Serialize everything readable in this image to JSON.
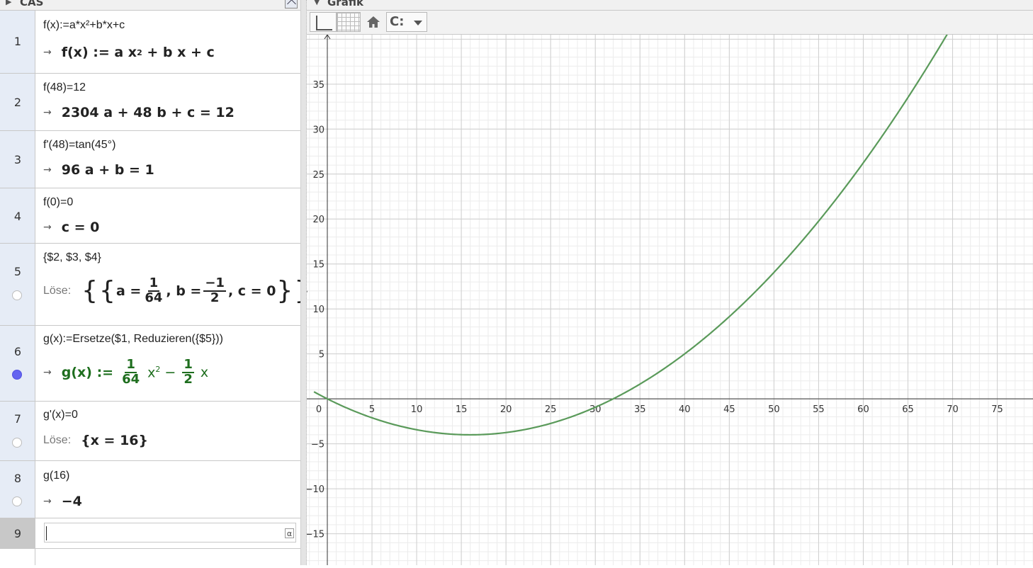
{
  "cas": {
    "title": "CAS",
    "rows": [
      {
        "n": "1",
        "input": "f(x):=a*x²+b*x+c"
      },
      {
        "n": "2",
        "input": "f(48)=12",
        "output": "2304 a + 48 b + c = 12"
      },
      {
        "n": "3",
        "input": "f'(48)=tan(45°)",
        "output": "96 a + b = 1"
      },
      {
        "n": "4",
        "input": "f(0)=0",
        "output": "c = 0"
      },
      {
        "n": "5",
        "input": "{$2, $3, $4}",
        "label": "Löse:"
      },
      {
        "n": "6",
        "input": "g(x):=Ersetze($1, Reduzieren({$5}))"
      },
      {
        "n": "7",
        "input": "g'(x)=0",
        "label": "Löse:",
        "output": "{x = 16}"
      },
      {
        "n": "8",
        "input": "g(16)",
        "output": "−4"
      },
      {
        "n": "9",
        "input": ""
      }
    ],
    "row1_output": {
      "lhs": "f(x) := a x",
      "exp": "2",
      "rest": " + b x + c"
    },
    "row5_output": {
      "a": "a =",
      "a_num": "1",
      "a_den": "64",
      "b": ", b =",
      "b_num": "−1",
      "b_den": "2",
      "c": ", c = 0"
    },
    "row6_output": {
      "lhs": "g(x) :=",
      "n1": "1",
      "d1": "64",
      "x2": "x",
      "exp": "2",
      "minus": "−",
      "n2": "1",
      "d2": "2",
      "x": "x"
    },
    "arrow": "→",
    "alpha": "α"
  },
  "graphics": {
    "title": "Grafik",
    "style_button": "C:",
    "function_color": "#5a9a5a",
    "x_ticks": [
      "0",
      "5",
      "10",
      "15",
      "20",
      "25",
      "30",
      "35",
      "40",
      "45",
      "50",
      "55",
      "60",
      "65",
      "70",
      "75"
    ],
    "y_ticks": [
      "35",
      "30",
      "25",
      "20",
      "15",
      "10",
      "5",
      "−5",
      "−10",
      "−15"
    ]
  },
  "chart_data": {
    "type": "line",
    "series": [
      {
        "function": "g(x) = x²/64 − x/2",
        "x_range": [
          -1.5,
          69.5
        ]
      }
    ],
    "xlim": [
      -2.3,
      79
    ],
    "ylim": [
      -18.5,
      40.5
    ],
    "grid": true
  }
}
